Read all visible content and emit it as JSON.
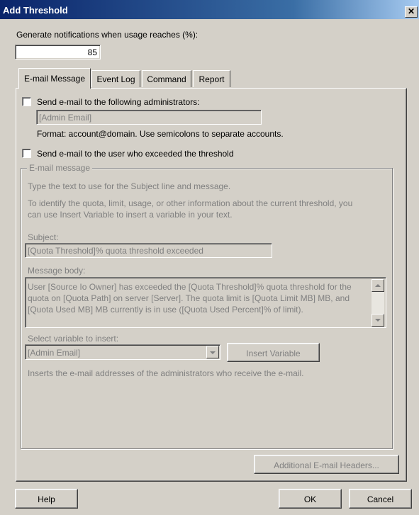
{
  "window": {
    "title": "Add Threshold",
    "close": "✕"
  },
  "threshold": {
    "label": "Generate notifications when usage reaches (%):",
    "value": "85"
  },
  "tabs": [
    {
      "label": "E-mail Message"
    },
    {
      "label": "Event Log"
    },
    {
      "label": "Command"
    },
    {
      "label": "Report"
    }
  ],
  "email": {
    "send_admins_label": "Send e-mail to the following administrators:",
    "admin_field_value": "[Admin Email]",
    "format_text": "Format: account@domain. Use semicolons to separate accounts.",
    "send_user_label": "Send e-mail to the user who exceeded the threshold",
    "group_label": "E-mail message",
    "instructions_1": "Type the text to use for the Subject line and message.",
    "instructions_2a": "To identify the quota, limit, usage, or other information about the current threshold, you",
    "instructions_2b": "can use Insert Variable to insert a variable in your text.",
    "subject_label": "Subject:",
    "subject_value": "[Quota Threshold]% quota threshold exceeded",
    "body_label": "Message body:",
    "body_value": "User [Source Io Owner] has exceeded the [Quota Threshold]% quota threshold for the quota on [Quota Path] on server [Server]. The quota limit is [Quota Limit MB] MB, and [Quota Used MB] MB currently is in use ([Quota Used Percent]% of limit).",
    "variable_label": "Select variable to insert:",
    "variable_value": "[Admin Email]",
    "insert_button": "Insert Variable",
    "variable_desc": "Inserts the e-mail addresses of the administrators who receive the e-mail.",
    "headers_button": "Additional E-mail Headers..."
  },
  "footer": {
    "help": "Help",
    "ok": "OK",
    "cancel": "Cancel"
  }
}
